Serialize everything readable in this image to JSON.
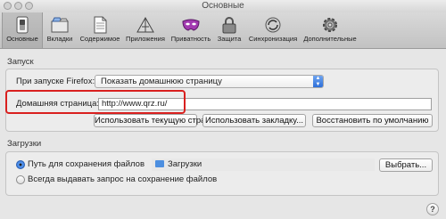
{
  "window": {
    "title": "Основные"
  },
  "toolbar": {
    "tabs": [
      {
        "label": "Основные",
        "icon": "switch-icon"
      },
      {
        "label": "Вкладки",
        "icon": "tabs-icon"
      },
      {
        "label": "Содержимое",
        "icon": "page-icon"
      },
      {
        "label": "Приложения",
        "icon": "apps-icon"
      },
      {
        "label": "Приватность",
        "icon": "mask-icon"
      },
      {
        "label": "Защита",
        "icon": "lock-icon"
      },
      {
        "label": "Синхронизация",
        "icon": "sync-icon"
      },
      {
        "label": "Дополнительные",
        "icon": "gear-icon"
      }
    ],
    "active": "Основные"
  },
  "startup": {
    "section_title": "Запуск",
    "on_start_label": "При запуске Firefox:",
    "on_start_value": "Показать домашнюю страницу",
    "homepage_label": "Домашняя страница:",
    "homepage_value": "http://www.qrz.ru/",
    "btn_current": "Использовать текущую страницу",
    "btn_bookmark": "Использовать закладку...",
    "btn_restore": "Восстановить по умолчанию"
  },
  "downloads": {
    "section_title": "Загрузки",
    "save_path_label": "Путь для сохранения файлов",
    "save_path_value": "Загрузки",
    "choose_btn": "Выбрать...",
    "ask_label": "Всегда выдавать запрос на сохранение файлов",
    "selected": "save_path"
  },
  "help": {
    "label": "?"
  },
  "colors": {
    "highlight": "#d9201f",
    "accent": "#2b6fd6"
  }
}
